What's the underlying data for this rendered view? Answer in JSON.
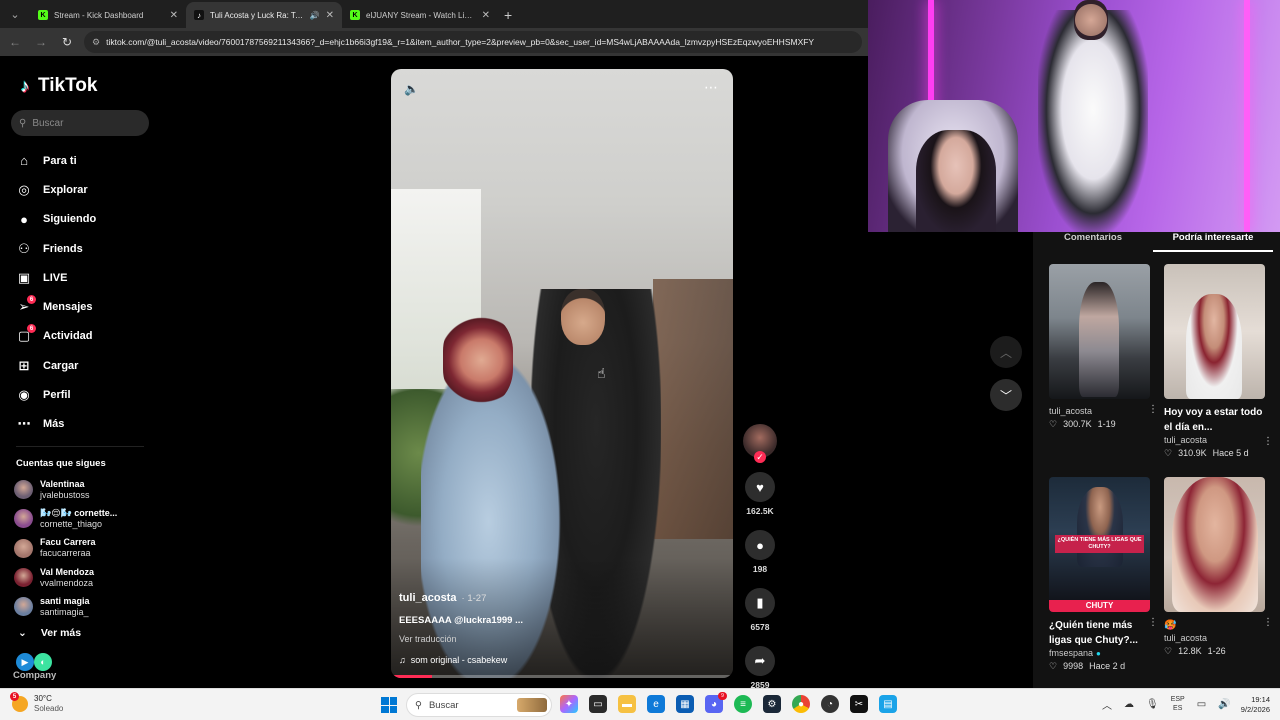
{
  "browser": {
    "tabs": [
      {
        "title": "Stream - Kick Dashboard",
        "favicon": "kick-icon",
        "active": false
      },
      {
        "title": "Tuli Acosta y Luck Ra: Tendencia",
        "favicon": "tiktok-icon",
        "active": true,
        "audio": true
      },
      {
        "title": "elJUANY Stream - Watch Live on Kick",
        "favicon": "kick-icon",
        "active": false
      }
    ],
    "new_tab_label": "+",
    "url": "tiktok.com/@tuli_acosta/video/7600178756921134366?_d=ehjc1b66i3gf19&_r=1&item_author_type=2&preview_pb=0&sec_user_id=MS4wLjABAAAAda_lzmvzpyHSEzEqzwyoEHHSMXFY"
  },
  "sidebar": {
    "logo": "TikTok",
    "search_placeholder": "Buscar",
    "nav": [
      {
        "label": "Para ti",
        "icon": "home-icon",
        "glyph": "⌂"
      },
      {
        "label": "Explorar",
        "icon": "compass-icon",
        "glyph": "◎"
      },
      {
        "label": "Siguiendo",
        "icon": "following-icon",
        "glyph": "●"
      },
      {
        "label": "Friends",
        "icon": "friends-icon",
        "glyph": "⚇"
      },
      {
        "label": "LIVE",
        "icon": "live-icon",
        "glyph": "▣"
      },
      {
        "label": "Mensajes",
        "icon": "messages-icon",
        "glyph": "➢",
        "badge": "6"
      },
      {
        "label": "Actividad",
        "icon": "activity-icon",
        "glyph": "▢",
        "badge": "6"
      },
      {
        "label": "Cargar",
        "icon": "upload-icon",
        "glyph": "⊞"
      },
      {
        "label": "Perfil",
        "icon": "profile-icon",
        "glyph": "◉"
      },
      {
        "label": "Más",
        "icon": "more-icon",
        "glyph": "⋯"
      }
    ],
    "following_title": "Cuentas que sigues",
    "following": [
      {
        "name": "Valentinaa",
        "user": "jvalebustoss"
      },
      {
        "name": "🌬️😌🌬️ cornette...",
        "user": "cornette_thiago"
      },
      {
        "name": "Facu Carrera",
        "user": "facucarreraa"
      },
      {
        "name": "Val Mendoza",
        "user": "vvalmendoza"
      },
      {
        "name": "santi magia",
        "user": "santimagia_"
      }
    ],
    "see_more": "Ver más",
    "company": "Company"
  },
  "video": {
    "author": "tuli_acosta",
    "date": "· 1-27",
    "caption": "EEESAAAA @luckra1999 ...",
    "translate": "Ver traducción",
    "sound": "som original - csabekew",
    "progress": 0.12
  },
  "actions": {
    "likes": "162.5K",
    "comments": "198",
    "saves": "6578",
    "shares": "2859"
  },
  "right_panel": {
    "tabs": [
      "Comentarios",
      "Podría interesarte"
    ],
    "cards": [
      {
        "user": "tuli_acosta",
        "title": "",
        "views": "300.7K",
        "date": "1-19"
      },
      {
        "user": "tuli_acosta",
        "title": "Hoy voy a estar todo el día en...",
        "views": "310.9K",
        "date": "Hace 5 d"
      },
      {
        "user": "fmsespana",
        "title": "¿Quién tiene más ligas que Chuty?...",
        "views": "9998",
        "date": "Hace 2 d",
        "thumb_text": "¿QUIÉN TIENE MÁS LIGAS QUE CHUTY?",
        "thumb_text2": "CHUTY"
      },
      {
        "user": "tuli_acosta",
        "title": "🥵",
        "views": "12.8K",
        "date": "1-26"
      }
    ]
  },
  "taskbar": {
    "temperature": "30°C",
    "condition": "Soleado",
    "weather_badge": "5",
    "search_placeholder": "Buscar",
    "lang_top": "ESP",
    "lang_bottom": "ES",
    "time": "19:14",
    "date": "9/2/2026"
  }
}
